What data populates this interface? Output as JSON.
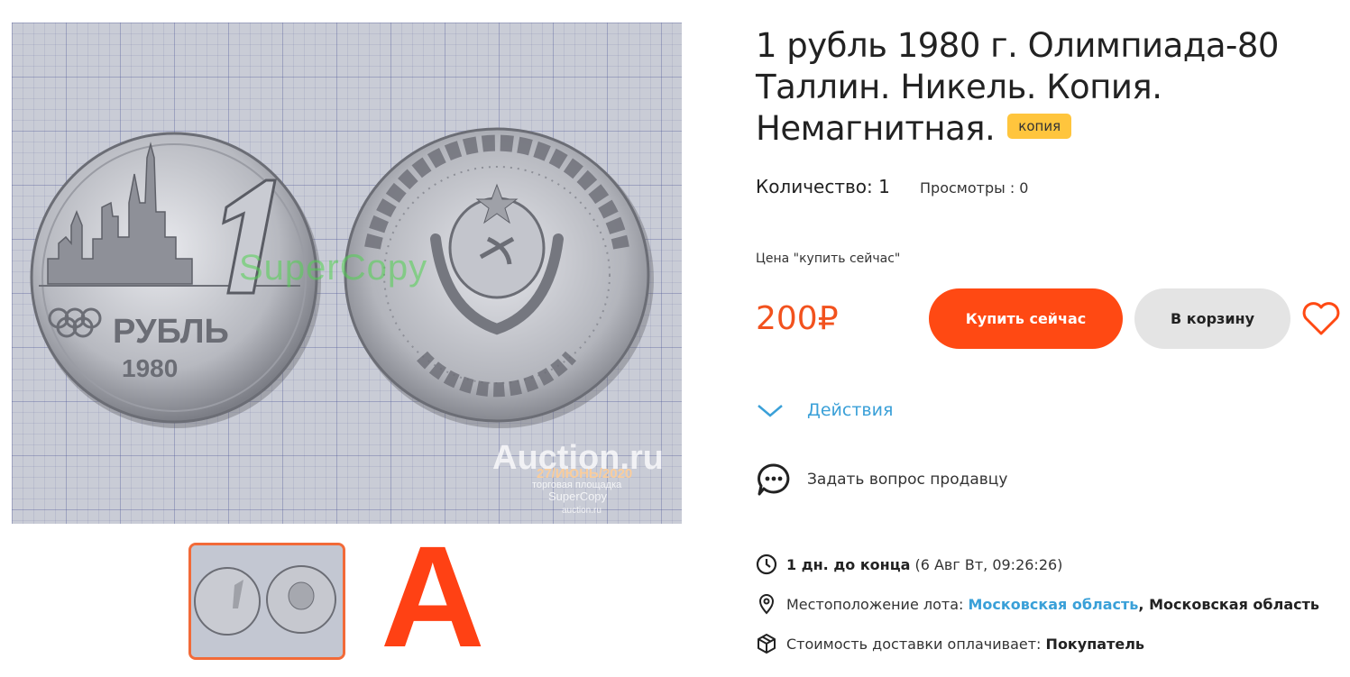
{
  "gallery": {
    "watermarks": {
      "main": "SuperCopy",
      "site": "Auction.ru",
      "date": "27/ИЮНЬ/2020",
      "subtitle": "торговая площадка",
      "seller": "SuperCopy",
      "url": "auction.ru"
    },
    "coin_text": {
      "denomination": "1",
      "currency": "РУБЛЬ",
      "year": "1980"
    },
    "logo_letter": "A"
  },
  "lot": {
    "title": "1 рубль 1980 г. Олимпиада-80 Таллин. Никель. Копия. Немагнитная.",
    "badge": "копия",
    "quantity": "Количество: 1",
    "views": "Просмотры : 0",
    "price_label": "Цена \"купить сейчас\"",
    "price": "200₽"
  },
  "buttons": {
    "buy_now": "Купить сейчас",
    "add_to_cart": "В корзину"
  },
  "actions_label": "Действия",
  "ask_seller": "Задать вопрос продавцу",
  "info": {
    "time_left": "1 дн. до конца",
    "end_date": "(6 Авг Вт, 09:26:26)",
    "location_label": "Местоположение лота:",
    "location_region": "Московская область",
    "location_city": ", Московская область",
    "shipping_label": "Стоимость доставки оплачивает:",
    "shipping_payer": "Покупатель"
  },
  "colors": {
    "accent": "#ff4913",
    "price": "#f2521e",
    "link": "#3aa0d8",
    "badge": "#ffc53d",
    "thumb_border": "#f26a38"
  },
  "icons": [
    "heart-icon",
    "chevron-down-icon",
    "chat-icon",
    "clock-icon",
    "location-pin-icon",
    "box-icon"
  ]
}
